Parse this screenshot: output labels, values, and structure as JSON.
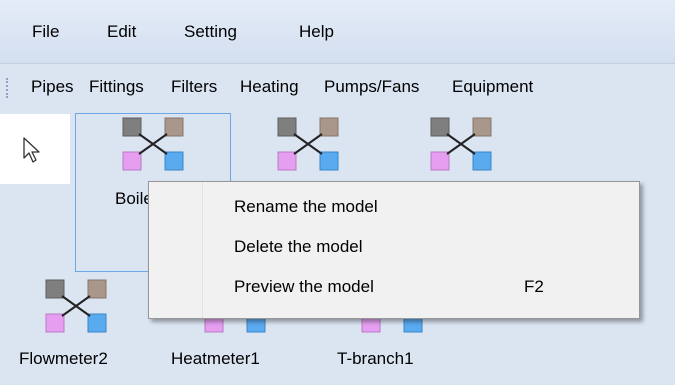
{
  "menubar": {
    "items": [
      "File",
      "Edit",
      "Setting",
      "Help"
    ]
  },
  "toolbar": {
    "items": [
      "Pipes",
      "Fittings",
      "Filters",
      "Heating",
      "Pumps/Fans",
      "Equipment"
    ]
  },
  "canvas": {
    "pointer_icon": "arrow-pointer-icon",
    "model_icon": "crossed-squares-icon",
    "models_row1": [
      "Boile",
      "",
      ""
    ],
    "models_row2": [
      "Flowmeter2",
      "Heatmeter1",
      "T-branch1"
    ],
    "icon_colors": {
      "top_left": "#7f7f7f",
      "top_right": "#a8978a",
      "bottom_left": "#e59ef0",
      "bottom_right": "#5aaaf0"
    }
  },
  "context_menu": {
    "items": [
      {
        "label": "Rename the model",
        "shortcut": ""
      },
      {
        "label": "Delete the model",
        "shortcut": ""
      },
      {
        "label": "Preview the model",
        "shortcut": "F2"
      }
    ]
  }
}
